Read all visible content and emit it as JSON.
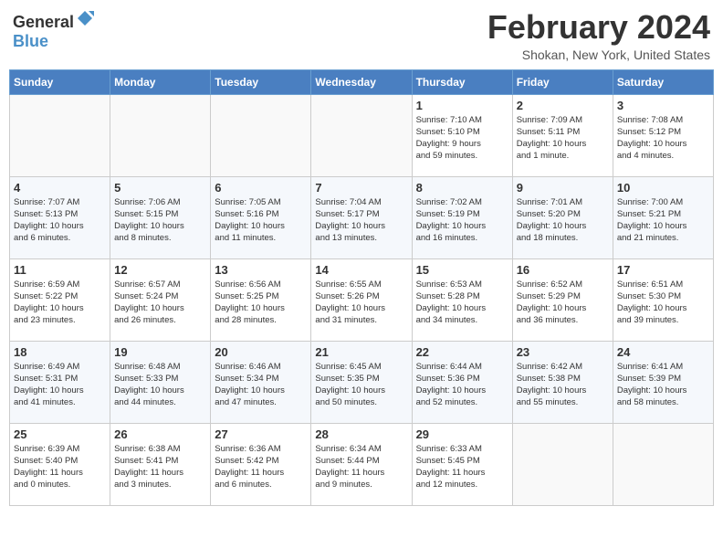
{
  "header": {
    "logo_general": "General",
    "logo_blue": "Blue",
    "month_title": "February 2024",
    "location": "Shokan, New York, United States"
  },
  "days_of_week": [
    "Sunday",
    "Monday",
    "Tuesday",
    "Wednesday",
    "Thursday",
    "Friday",
    "Saturday"
  ],
  "weeks": [
    [
      {
        "day": "",
        "info": ""
      },
      {
        "day": "",
        "info": ""
      },
      {
        "day": "",
        "info": ""
      },
      {
        "day": "",
        "info": ""
      },
      {
        "day": "1",
        "info": "Sunrise: 7:10 AM\nSunset: 5:10 PM\nDaylight: 9 hours\nand 59 minutes."
      },
      {
        "day": "2",
        "info": "Sunrise: 7:09 AM\nSunset: 5:11 PM\nDaylight: 10 hours\nand 1 minute."
      },
      {
        "day": "3",
        "info": "Sunrise: 7:08 AM\nSunset: 5:12 PM\nDaylight: 10 hours\nand 4 minutes."
      }
    ],
    [
      {
        "day": "4",
        "info": "Sunrise: 7:07 AM\nSunset: 5:13 PM\nDaylight: 10 hours\nand 6 minutes."
      },
      {
        "day": "5",
        "info": "Sunrise: 7:06 AM\nSunset: 5:15 PM\nDaylight: 10 hours\nand 8 minutes."
      },
      {
        "day": "6",
        "info": "Sunrise: 7:05 AM\nSunset: 5:16 PM\nDaylight: 10 hours\nand 11 minutes."
      },
      {
        "day": "7",
        "info": "Sunrise: 7:04 AM\nSunset: 5:17 PM\nDaylight: 10 hours\nand 13 minutes."
      },
      {
        "day": "8",
        "info": "Sunrise: 7:02 AM\nSunset: 5:19 PM\nDaylight: 10 hours\nand 16 minutes."
      },
      {
        "day": "9",
        "info": "Sunrise: 7:01 AM\nSunset: 5:20 PM\nDaylight: 10 hours\nand 18 minutes."
      },
      {
        "day": "10",
        "info": "Sunrise: 7:00 AM\nSunset: 5:21 PM\nDaylight: 10 hours\nand 21 minutes."
      }
    ],
    [
      {
        "day": "11",
        "info": "Sunrise: 6:59 AM\nSunset: 5:22 PM\nDaylight: 10 hours\nand 23 minutes."
      },
      {
        "day": "12",
        "info": "Sunrise: 6:57 AM\nSunset: 5:24 PM\nDaylight: 10 hours\nand 26 minutes."
      },
      {
        "day": "13",
        "info": "Sunrise: 6:56 AM\nSunset: 5:25 PM\nDaylight: 10 hours\nand 28 minutes."
      },
      {
        "day": "14",
        "info": "Sunrise: 6:55 AM\nSunset: 5:26 PM\nDaylight: 10 hours\nand 31 minutes."
      },
      {
        "day": "15",
        "info": "Sunrise: 6:53 AM\nSunset: 5:28 PM\nDaylight: 10 hours\nand 34 minutes."
      },
      {
        "day": "16",
        "info": "Sunrise: 6:52 AM\nSunset: 5:29 PM\nDaylight: 10 hours\nand 36 minutes."
      },
      {
        "day": "17",
        "info": "Sunrise: 6:51 AM\nSunset: 5:30 PM\nDaylight: 10 hours\nand 39 minutes."
      }
    ],
    [
      {
        "day": "18",
        "info": "Sunrise: 6:49 AM\nSunset: 5:31 PM\nDaylight: 10 hours\nand 41 minutes."
      },
      {
        "day": "19",
        "info": "Sunrise: 6:48 AM\nSunset: 5:33 PM\nDaylight: 10 hours\nand 44 minutes."
      },
      {
        "day": "20",
        "info": "Sunrise: 6:46 AM\nSunset: 5:34 PM\nDaylight: 10 hours\nand 47 minutes."
      },
      {
        "day": "21",
        "info": "Sunrise: 6:45 AM\nSunset: 5:35 PM\nDaylight: 10 hours\nand 50 minutes."
      },
      {
        "day": "22",
        "info": "Sunrise: 6:44 AM\nSunset: 5:36 PM\nDaylight: 10 hours\nand 52 minutes."
      },
      {
        "day": "23",
        "info": "Sunrise: 6:42 AM\nSunset: 5:38 PM\nDaylight: 10 hours\nand 55 minutes."
      },
      {
        "day": "24",
        "info": "Sunrise: 6:41 AM\nSunset: 5:39 PM\nDaylight: 10 hours\nand 58 minutes."
      }
    ],
    [
      {
        "day": "25",
        "info": "Sunrise: 6:39 AM\nSunset: 5:40 PM\nDaylight: 11 hours\nand 0 minutes."
      },
      {
        "day": "26",
        "info": "Sunrise: 6:38 AM\nSunset: 5:41 PM\nDaylight: 11 hours\nand 3 minutes."
      },
      {
        "day": "27",
        "info": "Sunrise: 6:36 AM\nSunset: 5:42 PM\nDaylight: 11 hours\nand 6 minutes."
      },
      {
        "day": "28",
        "info": "Sunrise: 6:34 AM\nSunset: 5:44 PM\nDaylight: 11 hours\nand 9 minutes."
      },
      {
        "day": "29",
        "info": "Sunrise: 6:33 AM\nSunset: 5:45 PM\nDaylight: 11 hours\nand 12 minutes."
      },
      {
        "day": "",
        "info": ""
      },
      {
        "day": "",
        "info": ""
      }
    ]
  ]
}
